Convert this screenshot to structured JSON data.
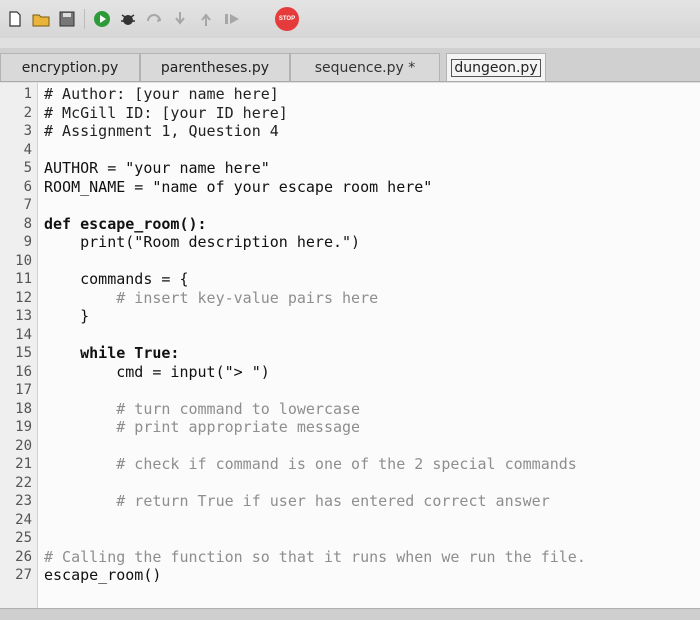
{
  "tabs": [
    {
      "label": "encryption.py"
    },
    {
      "label": "parentheses.py"
    },
    {
      "label": "sequence.py *"
    },
    {
      "label": "dungeon.py"
    }
  ],
  "toolbar": {
    "stop_label": "STOP",
    "icons": [
      "new-file-icon",
      "open-folder-icon",
      "save-icon",
      "run-icon",
      "debug-icon",
      "step-over-icon",
      "step-into-icon",
      "step-out-icon",
      "resume-icon",
      "stop-icon"
    ]
  },
  "editor": {
    "lines": [
      {
        "n": "1",
        "text": "# Author: [your name here]",
        "style": "cm"
      },
      {
        "n": "2",
        "text": "# McGill ID: [your ID here]",
        "style": "cm"
      },
      {
        "n": "3",
        "text": "# Assignment 1, Question 4",
        "style": "cm"
      },
      {
        "n": "4",
        "text": "",
        "style": ""
      },
      {
        "n": "5",
        "text": "AUTHOR = \"your name here\"",
        "style": ""
      },
      {
        "n": "6",
        "text": "ROOM_NAME = \"name of your escape room here\"",
        "style": ""
      },
      {
        "n": "7",
        "text": "",
        "style": ""
      },
      {
        "n": "8",
        "text": "def escape_room():",
        "style": "kw"
      },
      {
        "n": "9",
        "text": "    print(\"Room description here.\")",
        "style": ""
      },
      {
        "n": "10",
        "text": "",
        "style": ""
      },
      {
        "n": "11",
        "text": "    commands = {",
        "style": ""
      },
      {
        "n": "12",
        "text": "        # insert key-value pairs here",
        "style": "cm-light"
      },
      {
        "n": "13",
        "text": "    }",
        "style": ""
      },
      {
        "n": "14",
        "text": "",
        "style": ""
      },
      {
        "n": "15",
        "text": "    while True:",
        "style": "kw"
      },
      {
        "n": "16",
        "text": "        cmd = input(\"> \")",
        "style": ""
      },
      {
        "n": "17",
        "text": "",
        "style": ""
      },
      {
        "n": "18",
        "text": "        # turn command to lowercase",
        "style": "cm-light"
      },
      {
        "n": "19",
        "text": "        # print appropriate message",
        "style": "cm-light"
      },
      {
        "n": "20",
        "text": "",
        "style": ""
      },
      {
        "n": "21",
        "text": "        # check if command is one of the 2 special commands",
        "style": "cm-light"
      },
      {
        "n": "22",
        "text": "",
        "style": ""
      },
      {
        "n": "23",
        "text": "        # return True if user has entered correct answer",
        "style": "cm-light"
      },
      {
        "n": "24",
        "text": "",
        "style": ""
      },
      {
        "n": "25",
        "text": "",
        "style": ""
      },
      {
        "n": "26",
        "text": "# Calling the function so that it runs when we run the file.",
        "style": "cm-light"
      },
      {
        "n": "27",
        "text": "escape_room()",
        "style": ""
      }
    ]
  }
}
